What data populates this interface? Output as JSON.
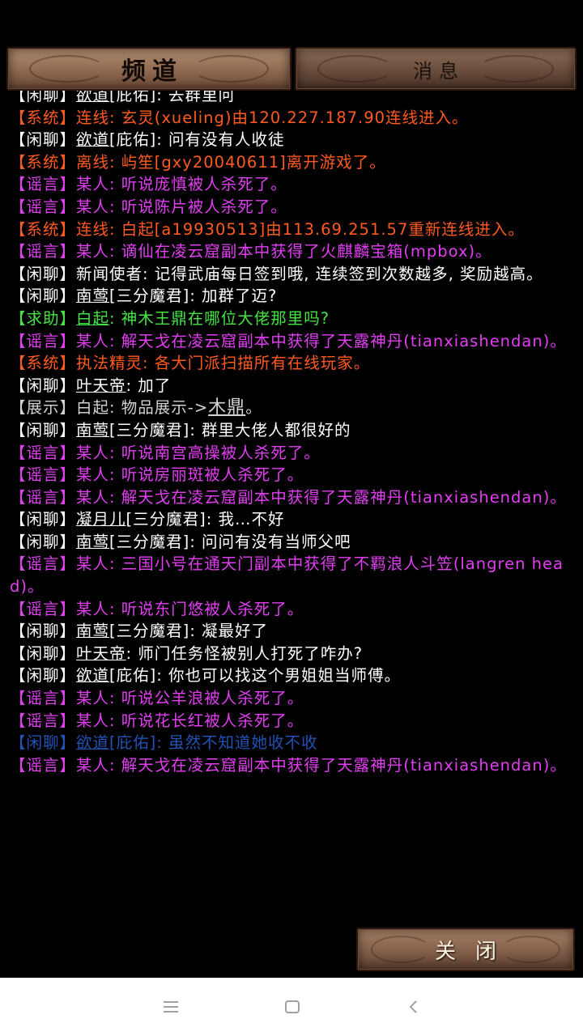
{
  "tabs": {
    "channel": "频道",
    "message": "消息"
  },
  "close_label": "关闭",
  "colors": {
    "system": "#ff5a1f",
    "chat": "#ffffff",
    "rumor": "#e23ef2",
    "help": "#43e443",
    "show": "#d2d2d2",
    "blue": "#2f6ef0"
  },
  "messages": [
    {
      "type": "chat",
      "tag": "【闲聊】",
      "speaker": "欲道",
      "text": "[庇佑]: 去群里问"
    },
    {
      "type": "system",
      "tag": "【系统】",
      "speaker": "",
      "text": "连线: 玄灵(xueling)由120.227.187.90连线进入。"
    },
    {
      "type": "chat",
      "tag": "【闲聊】",
      "speaker": "欲道",
      "text": "[庇佑]: 问有没有人收徒"
    },
    {
      "type": "system",
      "tag": "【系统】",
      "speaker": "",
      "text": "离线: 屿笙[gxy20040611]离开游戏了。"
    },
    {
      "type": "rumor",
      "tag": "【谣言】",
      "speaker": "",
      "text": "某人: 听说庞慎被人杀死了。"
    },
    {
      "type": "rumor",
      "tag": "【谣言】",
      "speaker": "",
      "text": "某人: 听说陈片被人杀死了。"
    },
    {
      "type": "system",
      "tag": "【系统】",
      "speaker": "",
      "text": "连线: 白起[a19930513]由113.69.251.57重新连线进入。"
    },
    {
      "type": "rumor",
      "tag": "【谣言】",
      "speaker": "",
      "text": "某人: 谪仙在凌云窟副本中获得了火麒麟宝箱(mpbox)。"
    },
    {
      "type": "chat",
      "tag": "【闲聊】",
      "speaker": "",
      "text": "新闻使者: 记得武庙每日签到哦, 连续签到次数越多, 奖励越高。"
    },
    {
      "type": "chat",
      "tag": "【闲聊】",
      "speaker": "南莺",
      "text": "[三分魔君]: 加群了迈?"
    },
    {
      "type": "help",
      "tag": "【求助】",
      "speaker": "白起",
      "text": ": 神木王鼎在哪位大佬那里吗?"
    },
    {
      "type": "rumor",
      "tag": "【谣言】",
      "speaker": "",
      "text": "某人: 解天戈在凌云窟副本中获得了天露神丹(tianxiashendan)。"
    },
    {
      "type": "system",
      "tag": "【系统】",
      "speaker": "",
      "text": "执法精灵: 各大门派扫描所有在线玩家。"
    },
    {
      "type": "chat",
      "tag": "【闲聊】",
      "speaker": "叶天帝",
      "text": ": 加了"
    },
    {
      "type": "show",
      "tag": "【展示】",
      "speaker": "",
      "text": "白起: 物品展示->",
      "item": "木鼎",
      "suffix": "。"
    },
    {
      "type": "chat",
      "tag": "【闲聊】",
      "speaker": "南莺",
      "text": "[三分魔君]: 群里大佬人都很好的"
    },
    {
      "type": "rumor",
      "tag": "【谣言】",
      "speaker": "",
      "text": "某人: 听说南宫高操被人杀死了。"
    },
    {
      "type": "rumor",
      "tag": "【谣言】",
      "speaker": "",
      "text": "某人: 听说房丽斑被人杀死了。"
    },
    {
      "type": "rumor",
      "tag": "【谣言】",
      "speaker": "",
      "text": "某人: 解天戈在凌云窟副本中获得了天露神丹(tianxiashendan)。"
    },
    {
      "type": "chat",
      "tag": "【闲聊】",
      "speaker": "凝月儿",
      "text": "[三分魔君]: 我…不好"
    },
    {
      "type": "chat",
      "tag": "【闲聊】",
      "speaker": "南莺",
      "text": "[三分魔君]: 问问有没有当师父吧"
    },
    {
      "type": "rumor",
      "tag": "【谣言】",
      "speaker": "",
      "text": "某人: 三国小号在通天门副本中获得了不羁浪人斗笠(langren head)。"
    },
    {
      "type": "rumor",
      "tag": "【谣言】",
      "speaker": "",
      "text": "某人: 听说东门悠被人杀死了。"
    },
    {
      "type": "chat",
      "tag": "【闲聊】",
      "speaker": "南莺",
      "text": "[三分魔君]: 凝最好了"
    },
    {
      "type": "chat",
      "tag": "【闲聊】",
      "speaker": "叶天帝",
      "text": ": 师门任务怪被别人打死了咋办?"
    },
    {
      "type": "chat",
      "tag": "【闲聊】",
      "speaker": "欲道",
      "text": "[庇佑]: 你也可以找这个男姐姐当师傅。"
    },
    {
      "type": "rumor",
      "tag": "【谣言】",
      "speaker": "",
      "text": "某人: 听说公羊浪被人杀死了。"
    },
    {
      "type": "rumor",
      "tag": "【谣言】",
      "speaker": "",
      "text": "某人: 听说花长红被人杀死了。"
    },
    {
      "type": "blue",
      "tag": "【闲聊】",
      "speaker": "欲道",
      "text": "[庇佑]: 虽然不知道她收不收"
    },
    {
      "type": "rumor",
      "tag": "【谣言】",
      "speaker": "",
      "text": "某人: 解天戈在凌云窟副本中获得了天露神丹(tianxiashendan)。"
    }
  ]
}
